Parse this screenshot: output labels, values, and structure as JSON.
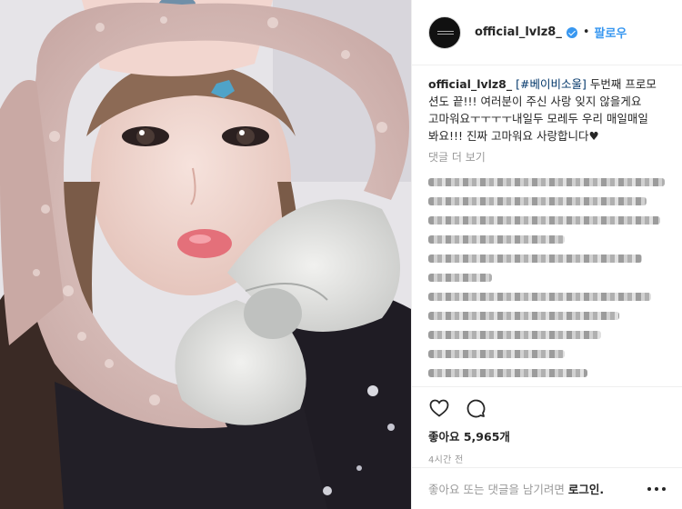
{
  "post": {
    "username": "official_lvlz8_",
    "verified": true,
    "separator": "•",
    "follow_label": "팔로우",
    "caption": {
      "user": "official_lvlz8_",
      "tag": "[#베이비소울]",
      "text": "두번째 프로모 션도 끝!!! 여러분이 주신 사랑 잊지 않을게요 고마워요ㅜㅜㅜㅜ내일두 모레두 우리 매일매일 봐요!!! 진짜 고마워요 사랑합니다♥"
    },
    "view_more_comments": "댓글 더 보기",
    "last_comment_suffix": "♥♥",
    "likes": "좋아요 5,965개",
    "time_ago": "4시간 전",
    "login_prompt": "좋아요 또는 댓글을 남기려면",
    "login_link": "로그인."
  },
  "icons": {
    "like": "heart-icon",
    "comment": "comment-bubble-icon",
    "options": "more-options-icon"
  },
  "colors": {
    "link_blue": "#3897f0",
    "text": "#262626",
    "muted": "#999999",
    "border": "#efefef"
  }
}
